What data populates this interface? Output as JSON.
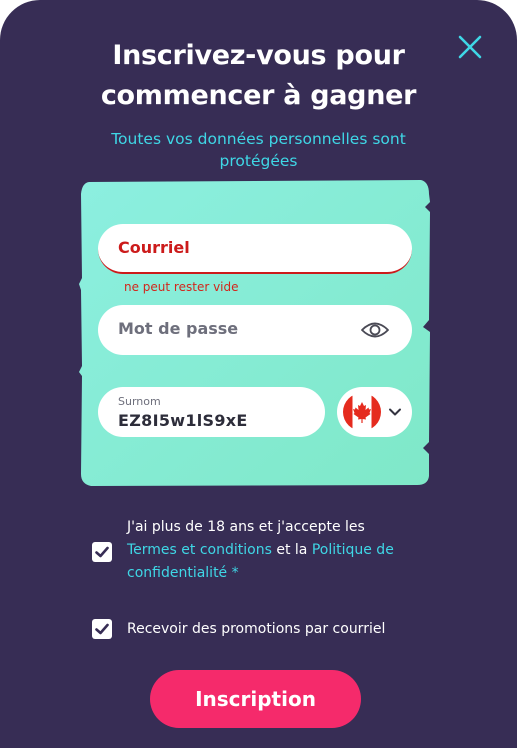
{
  "header": {
    "title_line1": "Inscrivez-vous pour",
    "title_line2": "commencer à gagner",
    "subtitle_line1": "Toutes vos données personnelles sont",
    "subtitle_line2": "protégées",
    "close_icon": "close-icon"
  },
  "form": {
    "email": {
      "placeholder": "Courriel",
      "value": "",
      "error": "ne peut rester vide"
    },
    "password": {
      "placeholder": "Mot de passe",
      "value": "",
      "toggle_icon": "eye-icon"
    },
    "nickname": {
      "label": "Surnom",
      "value": "EZ8I5w1lS9xE"
    },
    "country": {
      "selected_flag": "canada-flag-icon",
      "dropdown_icon": "chevron-down-icon"
    }
  },
  "consents": {
    "terms": {
      "checked": true,
      "text_part1": "J'ai plus de 18 ans et j'accepte les",
      "terms_link": "Termes et conditions",
      "text_part2": "et la",
      "privacy_link": "Politique de confidentialité",
      "suffix": "*"
    },
    "promotions": {
      "checked": true,
      "text": "Recevoir des promotions par courriel"
    }
  },
  "submit_label": "Inscription",
  "colors": {
    "background": "#372d55",
    "accent_cyan": "#3fd7e6",
    "card_mint": "#86ecd6",
    "button_pink": "#f52a6b",
    "error_red": "#cc1b1b"
  }
}
